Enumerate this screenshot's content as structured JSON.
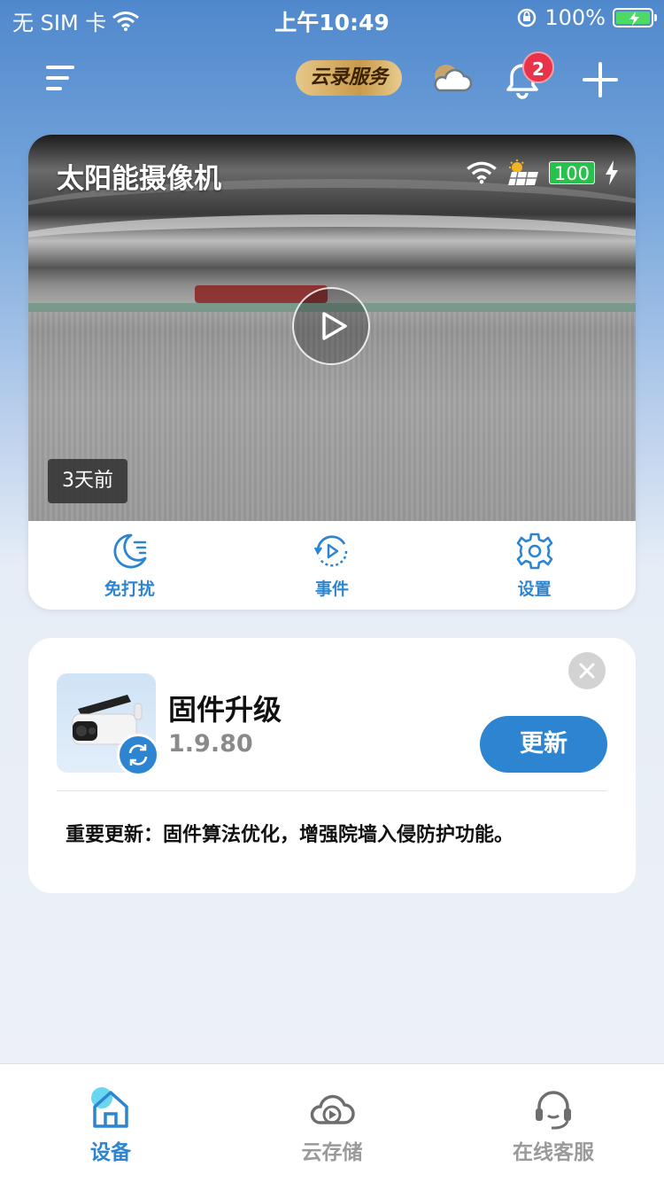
{
  "status_bar": {
    "carrier": "无 SIM 卡",
    "time": "上午10:49",
    "battery_percent": "100%",
    "icons": [
      "wifi-icon",
      "rotation-lock-icon",
      "battery-charging-icon"
    ]
  },
  "header": {
    "cloud_service_label": "云录服务",
    "notification_count": "2",
    "icons": [
      "menu-icon",
      "cloud-icon",
      "bell-icon",
      "plus-icon"
    ]
  },
  "camera": {
    "name": "太阳能摄像机",
    "battery": "100",
    "last_seen": "3天前",
    "icons": [
      "wifi-icon",
      "solar-panel-icon",
      "charging-icon",
      "play-icon"
    ],
    "actions": [
      {
        "label": "免打扰",
        "icon": "moon-icon"
      },
      {
        "label": "事件",
        "icon": "event-play-icon"
      },
      {
        "label": "设置",
        "icon": "gear-icon"
      }
    ]
  },
  "firmware": {
    "title": "固件升级",
    "version": "1.9.80",
    "update_label": "更新",
    "description": "重要更新：固件算法优化，增强院墙入侵防护功能。",
    "icons": [
      "close-icon",
      "sync-icon"
    ]
  },
  "tab_bar": {
    "tabs": [
      {
        "label": "设备",
        "icon": "home-icon",
        "active": true
      },
      {
        "label": "云存储",
        "icon": "cloud-play-icon",
        "active": false
      },
      {
        "label": "在线客服",
        "icon": "headset-icon",
        "active": false
      }
    ]
  },
  "colors": {
    "accent": "#2d85d2",
    "badge_red": "#e8334a",
    "battery_green": "#4cd964"
  }
}
